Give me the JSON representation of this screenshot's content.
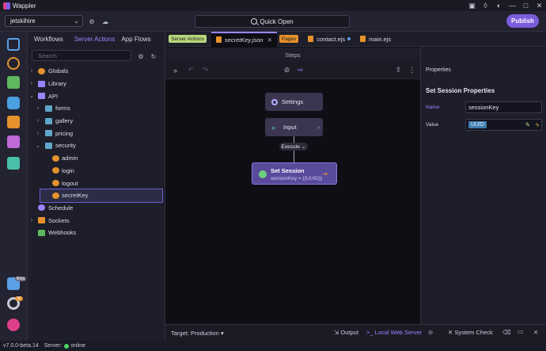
{
  "app": {
    "title": "Wappler"
  },
  "toolbar": {
    "project": "jetskihire",
    "quick_open": "Quick Open",
    "publish": "Publish"
  },
  "sidebar": {
    "tabs": [
      "Workflows",
      "Server Actions",
      "App Flows"
    ],
    "search_placeholder": "Search",
    "tree": [
      {
        "label": "Globals"
      },
      {
        "label": "Library"
      },
      {
        "label": "API"
      },
      {
        "label": "forms"
      },
      {
        "label": "gallery"
      },
      {
        "label": "pricing"
      },
      {
        "label": "security"
      },
      {
        "label": "admin"
      },
      {
        "label": "login"
      },
      {
        "label": "logout"
      },
      {
        "label": "secretKey"
      },
      {
        "label": "Schedule"
      },
      {
        "label": "Sockets"
      },
      {
        "label": "Webhooks"
      }
    ]
  },
  "tabs": {
    "server_actions_badge": "Server Actions",
    "secret_key": "secretKey.json",
    "pages_badge": "Pages",
    "contact": "contact.ejs",
    "main": "main.ejs"
  },
  "steps": {
    "header": "Steps",
    "settings": "Settings",
    "input": "Input",
    "execute": "Execute",
    "set_session_title": "Set Session",
    "set_session_sub": "sessionKey = {{UUID}}"
  },
  "properties": {
    "panel_title": "Properties",
    "section": "Set Session Properties",
    "name_label": "Name",
    "name_value": "sessionKey",
    "value_label": "Value",
    "value_token": "UUID"
  },
  "bottom": {
    "target_label": "Target:",
    "target_value": "Production",
    "output": "Output",
    "local_web_server": "Local Web Server",
    "system_check": "System Check"
  },
  "status": {
    "version": "v7.0.0-beta.14",
    "server_label": "Server:",
    "server_state": "online"
  },
  "rail_badges": {
    "b1": "Beta",
    "b2": "30"
  },
  "colors": {
    "accent": "#7c5cdc",
    "active_tab": "#9c84ff",
    "online": "#4fd16a"
  }
}
